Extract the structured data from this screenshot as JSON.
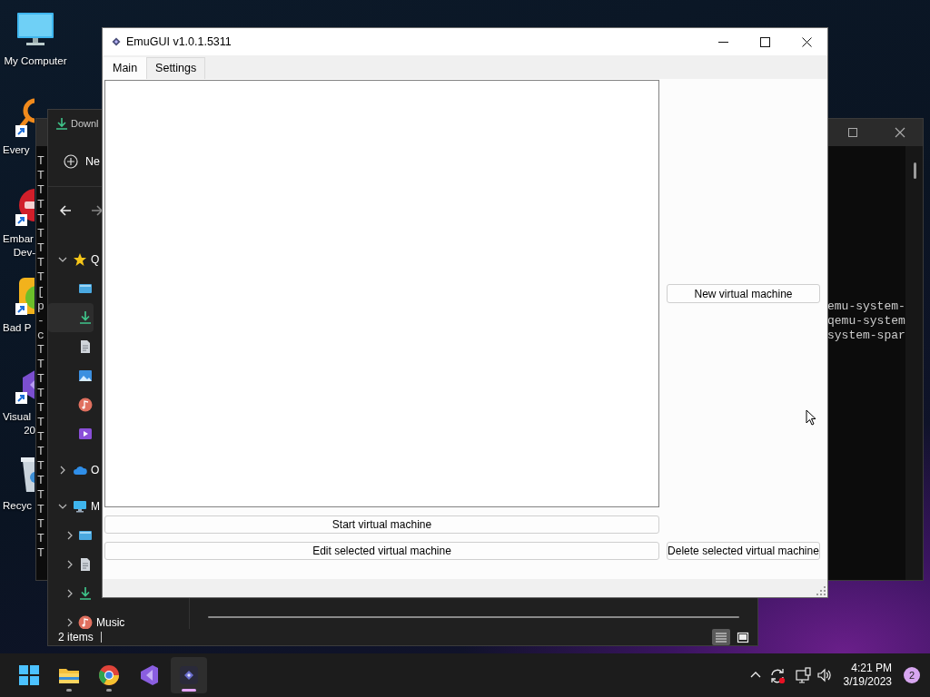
{
  "desktop_icons": [
    {
      "kind": "computer",
      "shortcut": false,
      "lines": [
        "My Computer"
      ]
    },
    {
      "kind": "search",
      "shortcut": true,
      "lines": [
        "Every"
      ]
    },
    {
      "kind": "dev",
      "shortcut": true,
      "lines": [
        "Embar",
        "Dev-"
      ]
    },
    {
      "kind": "game",
      "shortcut": true,
      "lines": [
        "Bad P"
      ]
    },
    {
      "kind": "ide",
      "shortcut": true,
      "lines": [
        "Visual",
        "20"
      ]
    },
    {
      "kind": "recycle",
      "shortcut": false,
      "lines": [
        "Recyc"
      ]
    }
  ],
  "terminal": {
    "lines": [
      {
        "left": "T"
      },
      {
        "left": "T"
      },
      {
        "left": "T"
      },
      {
        "left": "T"
      },
      {
        "left": "T"
      },
      {
        "left": "T"
      },
      {
        "left": "T"
      },
      {
        "left": "T"
      },
      {
        "left": "T"
      },
      {
        "left": "["
      },
      {
        "left": "p",
        "right": "emu-system-"
      },
      {
        "left": "-",
        "right": "qemu-system"
      },
      {
        "left": "c",
        "right": "system-spar"
      },
      {
        "left": "T"
      },
      {
        "left": "T"
      },
      {
        "left": "T"
      },
      {
        "left": "T"
      },
      {
        "left": "T"
      },
      {
        "left": "T"
      },
      {
        "left": "T"
      },
      {
        "left": "T"
      },
      {
        "left": "T"
      },
      {
        "left": "T"
      },
      {
        "left": "T"
      },
      {
        "left": "T"
      },
      {
        "left": "T"
      },
      {
        "left": "T"
      },
      {
        "left": "T"
      }
    ]
  },
  "explorer": {
    "title": "Downl",
    "new_label": "Ne",
    "sidebar": [
      {
        "kind": "star",
        "label": "Q",
        "expanded": true,
        "selected": false,
        "children": [
          {
            "kind": "desktop",
            "selected": false
          },
          {
            "kind": "download",
            "selected": true
          },
          {
            "kind": "document",
            "selected": false
          },
          {
            "kind": "pictures",
            "selected": false
          },
          {
            "kind": "music",
            "selected": false
          },
          {
            "kind": "videos",
            "selected": false
          }
        ]
      },
      {
        "kind": "cloud",
        "label": "O",
        "expanded": false,
        "selected": false
      },
      {
        "kind": "pc",
        "label": "M",
        "expanded": true,
        "selected": false,
        "children": [
          {
            "kind": "desktop",
            "expanded": false,
            "selected": false
          },
          {
            "kind": "document",
            "expanded": false,
            "selected": false
          },
          {
            "kind": "download",
            "expanded": false,
            "selected": false
          },
          {
            "kind": "music",
            "label": "Music",
            "expanded": false,
            "selected": false
          }
        ]
      }
    ],
    "status": "2 items",
    "views": [
      {
        "kind": "details",
        "selected": true
      },
      {
        "kind": "tiles",
        "selected": false
      }
    ]
  },
  "emugui": {
    "title": "EmuGUI v1.0.1.5311",
    "tabs": [
      {
        "label": "Main",
        "selected": true
      },
      {
        "label": "Settings",
        "selected": false
      }
    ],
    "new_button": "New virtual machine",
    "start_button": "Start virtual machine",
    "edit_button": "Edit selected virtual machine",
    "delete_button": "Delete selected virtual machine"
  },
  "taskbar": {
    "apps": [
      {
        "kind": "start",
        "running": false,
        "selected": false
      },
      {
        "kind": "folder",
        "running": true,
        "selected": false
      },
      {
        "kind": "browser",
        "running": true,
        "selected": false
      },
      {
        "kind": "ide",
        "running": false,
        "selected": false
      },
      {
        "kind": "emugui",
        "running": true,
        "selected": true
      }
    ],
    "time": "4:21 PM",
    "date": "3/19/2023",
    "notifications": "2"
  }
}
